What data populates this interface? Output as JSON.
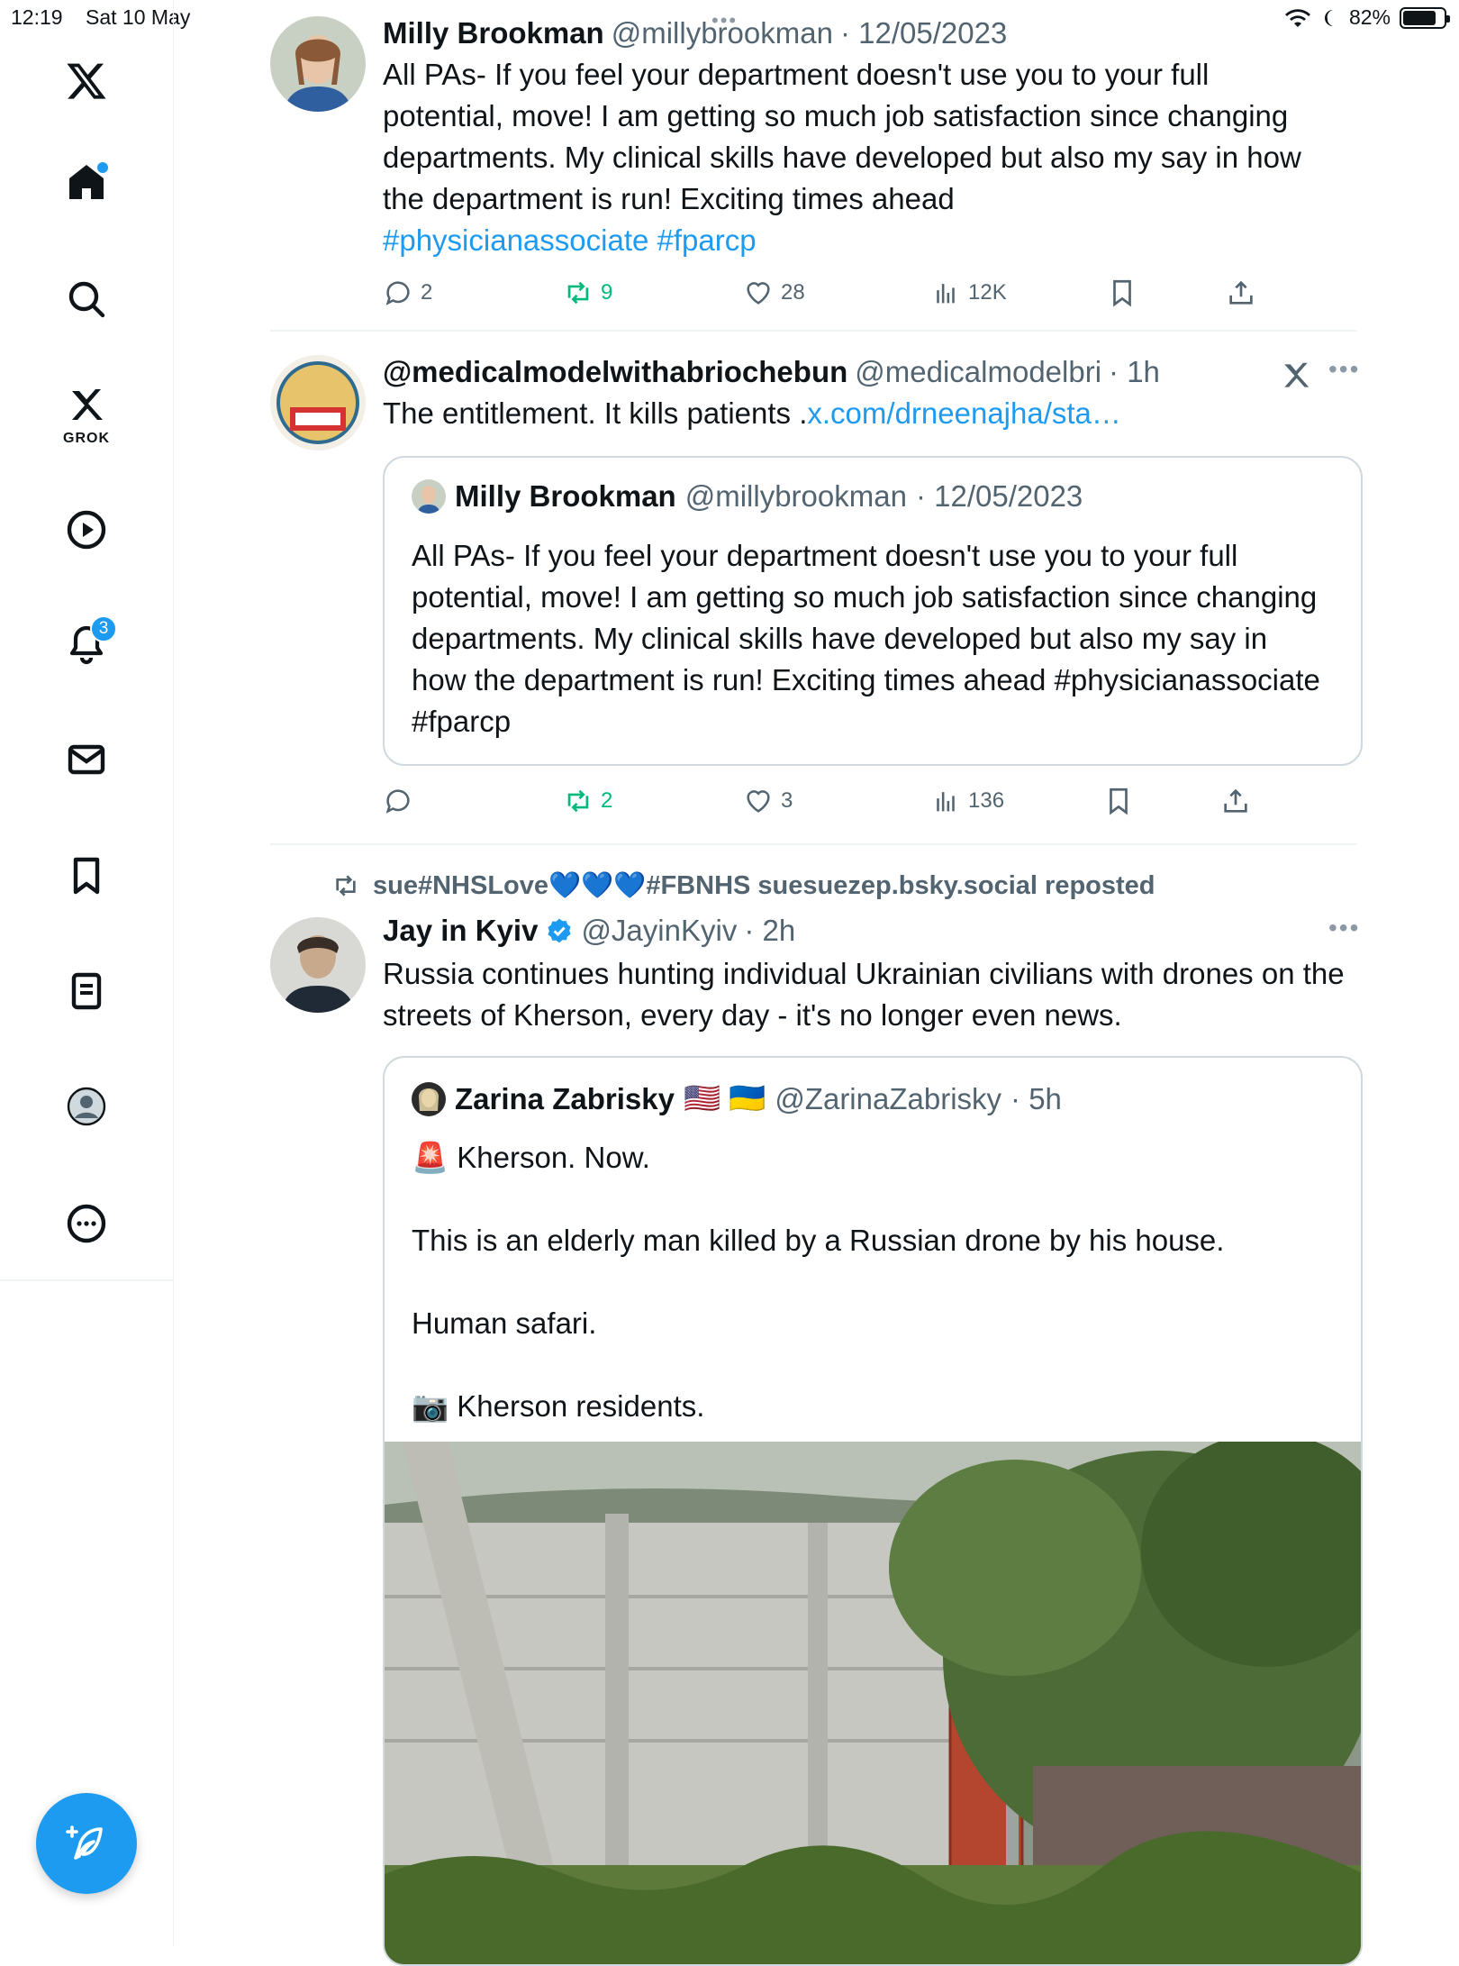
{
  "status_bar": {
    "time": "12:19",
    "date": "Sat 10 May",
    "battery": "82%"
  },
  "sidebar": {
    "grok_label": "GROK",
    "notifications_count": "3"
  },
  "posts": [
    {
      "name": "Milly Brookman",
      "handle": "@millybrookman",
      "time": "· 12/05/2023",
      "text": "All PAs- If you feel your department doesn't use you to your full potential, move! I am getting so much job satisfaction since changing departments. My clinical skills have developed but also my say in how the department is run! Exciting times ahead",
      "hashtags": "#physicianassociate #fparcp",
      "replies": "2",
      "reposts": "9",
      "likes": "28",
      "views": "12K"
    },
    {
      "name": "@medicalmodelwithabriochebun",
      "handle": "@medicalmodelbri",
      "time": "· 1h",
      "text_prefix": "The entitlement. It kills patients .",
      "link": "x.com/drneenajha/sta…",
      "quote": {
        "name": "Milly Brookman",
        "handle": "@millybrookman",
        "time": "· 12/05/2023",
        "text": "All PAs- If you feel your department doesn't use you to your full potential, move! I am getting so much job satisfaction since changing departments. My clinical skills have developed but also my say in how the department is run! Exciting times ahead #physicianassociate #fparcp"
      },
      "replies": "",
      "reposts": "2",
      "likes": "3",
      "views": "136"
    },
    {
      "reposted_by": "sue#NHSLove💙💙💙#FBNHS suesuezep.bsky.social reposted",
      "name": "Jay in Kyiv",
      "handle": "@JayinKyiv",
      "time": "· 2h",
      "text": "Russia continues hunting individual Ukrainian civilians with drones on the streets of Kherson, every day - it's no longer even news.",
      "quote": {
        "name": "Zarina Zabrisky",
        "flags": "🇺🇸 🇺🇦",
        "handle": "@ZarinaZabrisky",
        "time": "· 5h",
        "line1": "🚨 Kherson. Now.",
        "line2": "This is an elderly man killed by a Russian drone by his house.",
        "line3": "Human safari.",
        "line4": "📷 Kherson residents."
      }
    }
  ]
}
